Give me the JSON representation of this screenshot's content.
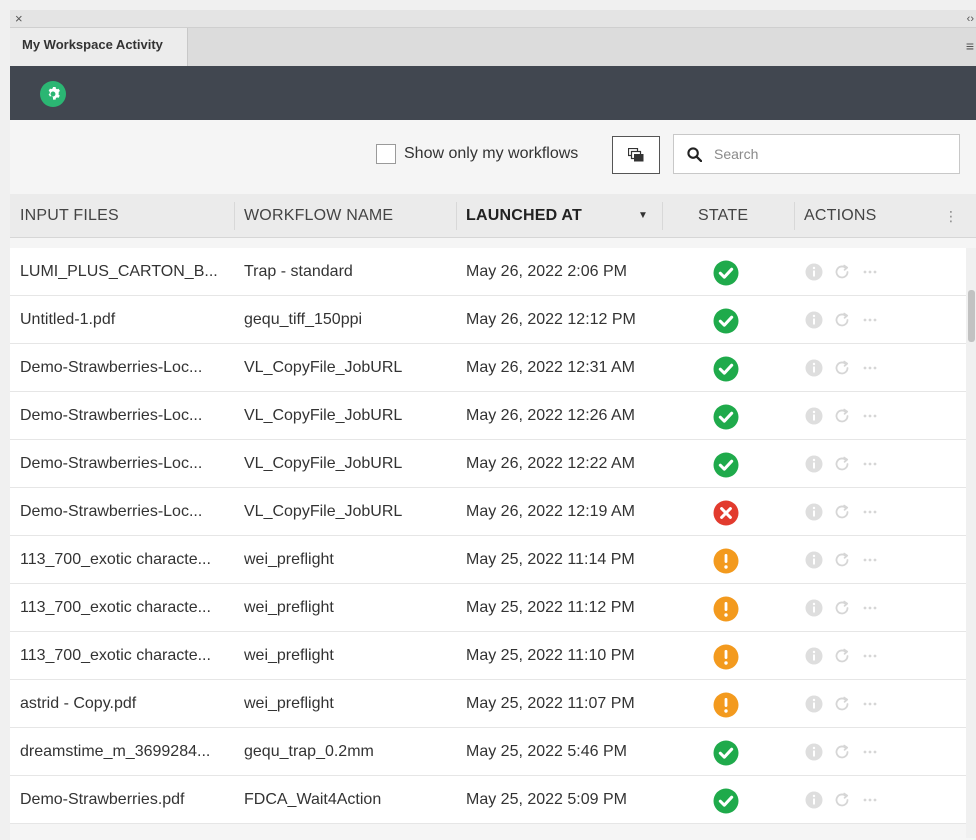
{
  "window": {
    "close_glyph": "×",
    "collapse_glyph": "‹›",
    "tab_label": "My Workspace Activity",
    "panel_menu_glyph": "≡"
  },
  "toolbar": {
    "gear_icon": "gear-icon",
    "accent_color": "#2bb673",
    "background_color": "#414750"
  },
  "filters": {
    "only_mine_label": "Show only my workflows",
    "only_mine_checked": false,
    "search_placeholder": "Search",
    "search_value": ""
  },
  "table": {
    "columns": [
      {
        "label": "INPUT FILES"
      },
      {
        "label": "WORKFLOW NAME"
      },
      {
        "label": "LAUNCHED AT"
      },
      {
        "label": "STATE"
      },
      {
        "label": "ACTIONS"
      }
    ],
    "sorted_by": "LAUNCHED AT",
    "sort_direction": "descending",
    "rows": [
      {
        "input": "LUMI_PLUS_CARTON_B...",
        "workflow": "Trap - standard",
        "launched": "May 26, 2022 2:06 PM",
        "state": "success"
      },
      {
        "input": "Untitled-1.pdf",
        "workflow": "gequ_tiff_150ppi",
        "launched": "May 26, 2022 12:12 PM",
        "state": "success"
      },
      {
        "input": "Demo-Strawberries-Loc...",
        "workflow": "VL_CopyFile_JobURL",
        "launched": "May 26, 2022 12:31 AM",
        "state": "success"
      },
      {
        "input": "Demo-Strawberries-Loc...",
        "workflow": "VL_CopyFile_JobURL",
        "launched": "May 26, 2022 12:26 AM",
        "state": "success"
      },
      {
        "input": "Demo-Strawberries-Loc...",
        "workflow": "VL_CopyFile_JobURL",
        "launched": "May 26, 2022 12:22 AM",
        "state": "success"
      },
      {
        "input": "Demo-Strawberries-Loc...",
        "workflow": "VL_CopyFile_JobURL",
        "launched": "May 26, 2022 12:19 AM",
        "state": "error"
      },
      {
        "input": "113_700_exotic characte...",
        "workflow": "wei_preflight",
        "launched": "May 25, 2022 11:14 PM",
        "state": "warning"
      },
      {
        "input": "113_700_exotic characte...",
        "workflow": "wei_preflight",
        "launched": "May 25, 2022 11:12 PM",
        "state": "warning"
      },
      {
        "input": "113_700_exotic characte...",
        "workflow": "wei_preflight",
        "launched": "May 25, 2022 11:10 PM",
        "state": "warning"
      },
      {
        "input": "astrid - Copy.pdf",
        "workflow": "wei_preflight",
        "launched": "May 25, 2022 11:07 PM",
        "state": "warning"
      },
      {
        "input": "dreamstime_m_3699284...",
        "workflow": "gequ_trap_0.2mm",
        "launched": "May 25, 2022 5:46 PM",
        "state": "success"
      },
      {
        "input": "Demo-Strawberries.pdf",
        "workflow": "FDCA_Wait4Action",
        "launched": "May 25, 2022 5:09 PM",
        "state": "success"
      }
    ]
  },
  "state_colors": {
    "success": "#1faa4b",
    "error": "#e23b2e",
    "warning": "#f39a1e"
  },
  "action_icons": [
    "info-icon",
    "retry-icon",
    "more-icon"
  ]
}
